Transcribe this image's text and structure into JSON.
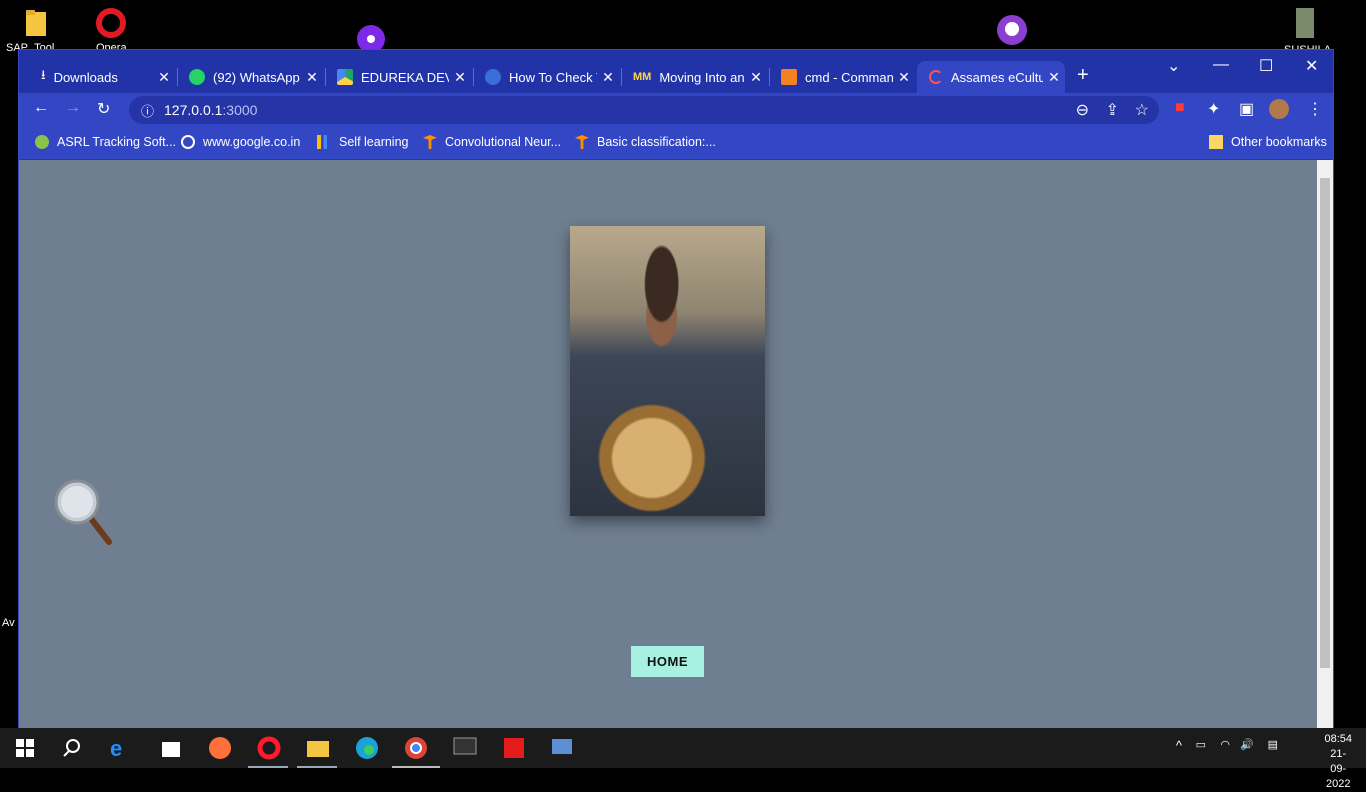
{
  "desktop": {
    "icons": [
      {
        "label": "SAP_Tool",
        "name": "folder-icon"
      },
      {
        "label": "Opera",
        "name": "opera-icon"
      },
      {
        "label": "",
        "name": "podcast-icon"
      },
      {
        "label": "",
        "name": "github-icon"
      },
      {
        "label": "SUSHILA",
        "name": "user-photo-icon"
      },
      {
        "label": "Av",
        "name": "app-icon"
      }
    ]
  },
  "browser": {
    "tabs": [
      {
        "title": "Downloads",
        "icon": "download-icon",
        "active": false
      },
      {
        "title": "(92) WhatsApp",
        "icon": "whatsapp-icon",
        "badge": "92",
        "active": false
      },
      {
        "title": "EDUREKA DEVO",
        "icon": "google-drive-icon",
        "active": false
      },
      {
        "title": "How To Check T",
        "icon": "globe-icon",
        "active": false
      },
      {
        "title": "Moving Into an",
        "icon": "mm-icon",
        "active": false
      },
      {
        "title": "cmd - Comman",
        "icon": "stackoverflow-icon",
        "active": false
      },
      {
        "title": "Assames eCultu",
        "icon": "loading-icon",
        "active": true
      }
    ],
    "url": {
      "host": "127.0.0.1",
      "port": ":3000"
    },
    "bookmarks": [
      {
        "label": "ASRL Tracking Soft...",
        "icon": "asrl-icon"
      },
      {
        "label": "www.google.co.in",
        "icon": "google-icon"
      },
      {
        "label": "Self learning",
        "icon": "chart-icon"
      },
      {
        "label": "Convolutional Neur...",
        "icon": "tensorflow-icon"
      },
      {
        "label": "Basic classification:...",
        "icon": "tensorflow-icon"
      }
    ],
    "other_bookmarks": "Other bookmarks"
  },
  "page": {
    "home_button": "HOME",
    "photo_alt": "Man holding a brass plate"
  },
  "taskbar": {
    "time": "08:54",
    "date": "21-09-2022"
  },
  "colors": {
    "page_bg": "#6f7f91",
    "home_button_bg": "#a8f0e2",
    "browser_frame": "#3346c4"
  }
}
